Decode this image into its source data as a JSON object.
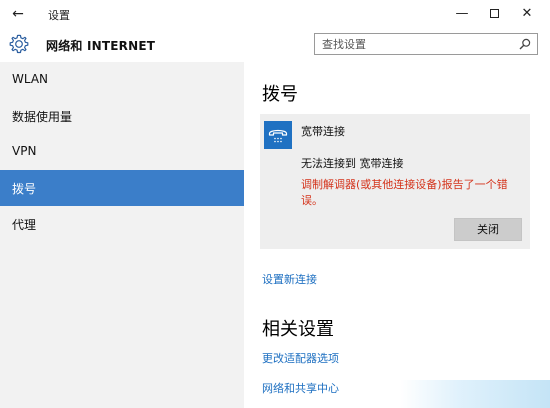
{
  "window": {
    "title": "设置",
    "back_glyph": "←",
    "minimize_glyph": "—",
    "close_glyph": "✕"
  },
  "header": {
    "title": "网络和 INTERNET",
    "icon": "gear-icon",
    "search_placeholder": "查找设置",
    "search_icon": "search-icon"
  },
  "sidebar": {
    "items": [
      {
        "label": "WLAN",
        "selected": false
      },
      {
        "label": "数据使用量",
        "selected": false
      },
      {
        "label": "VPN",
        "selected": false
      },
      {
        "label": "拨号",
        "selected": true
      },
      {
        "label": "代理",
        "selected": false
      }
    ]
  },
  "main": {
    "section_title": "拨号",
    "connection": {
      "icon": "phone-icon",
      "name": "宽带连接",
      "status": "无法连接到 宽带连接",
      "error": "调制解调器(或其他连接设备)报告了一个错误。",
      "close_label": "关闭"
    },
    "setup_link": "设置新连接",
    "related_title": "相关设置",
    "related_links": [
      "更改适配器选项",
      "网络和共享中心"
    ]
  },
  "colors": {
    "accent": "#3b7ec9",
    "link": "#1d6fc1",
    "error": "#d4331b",
    "sidebar_bg": "#f2f2f2",
    "card_bg": "#eeeeee",
    "icon_bg": "#1f71c2"
  }
}
